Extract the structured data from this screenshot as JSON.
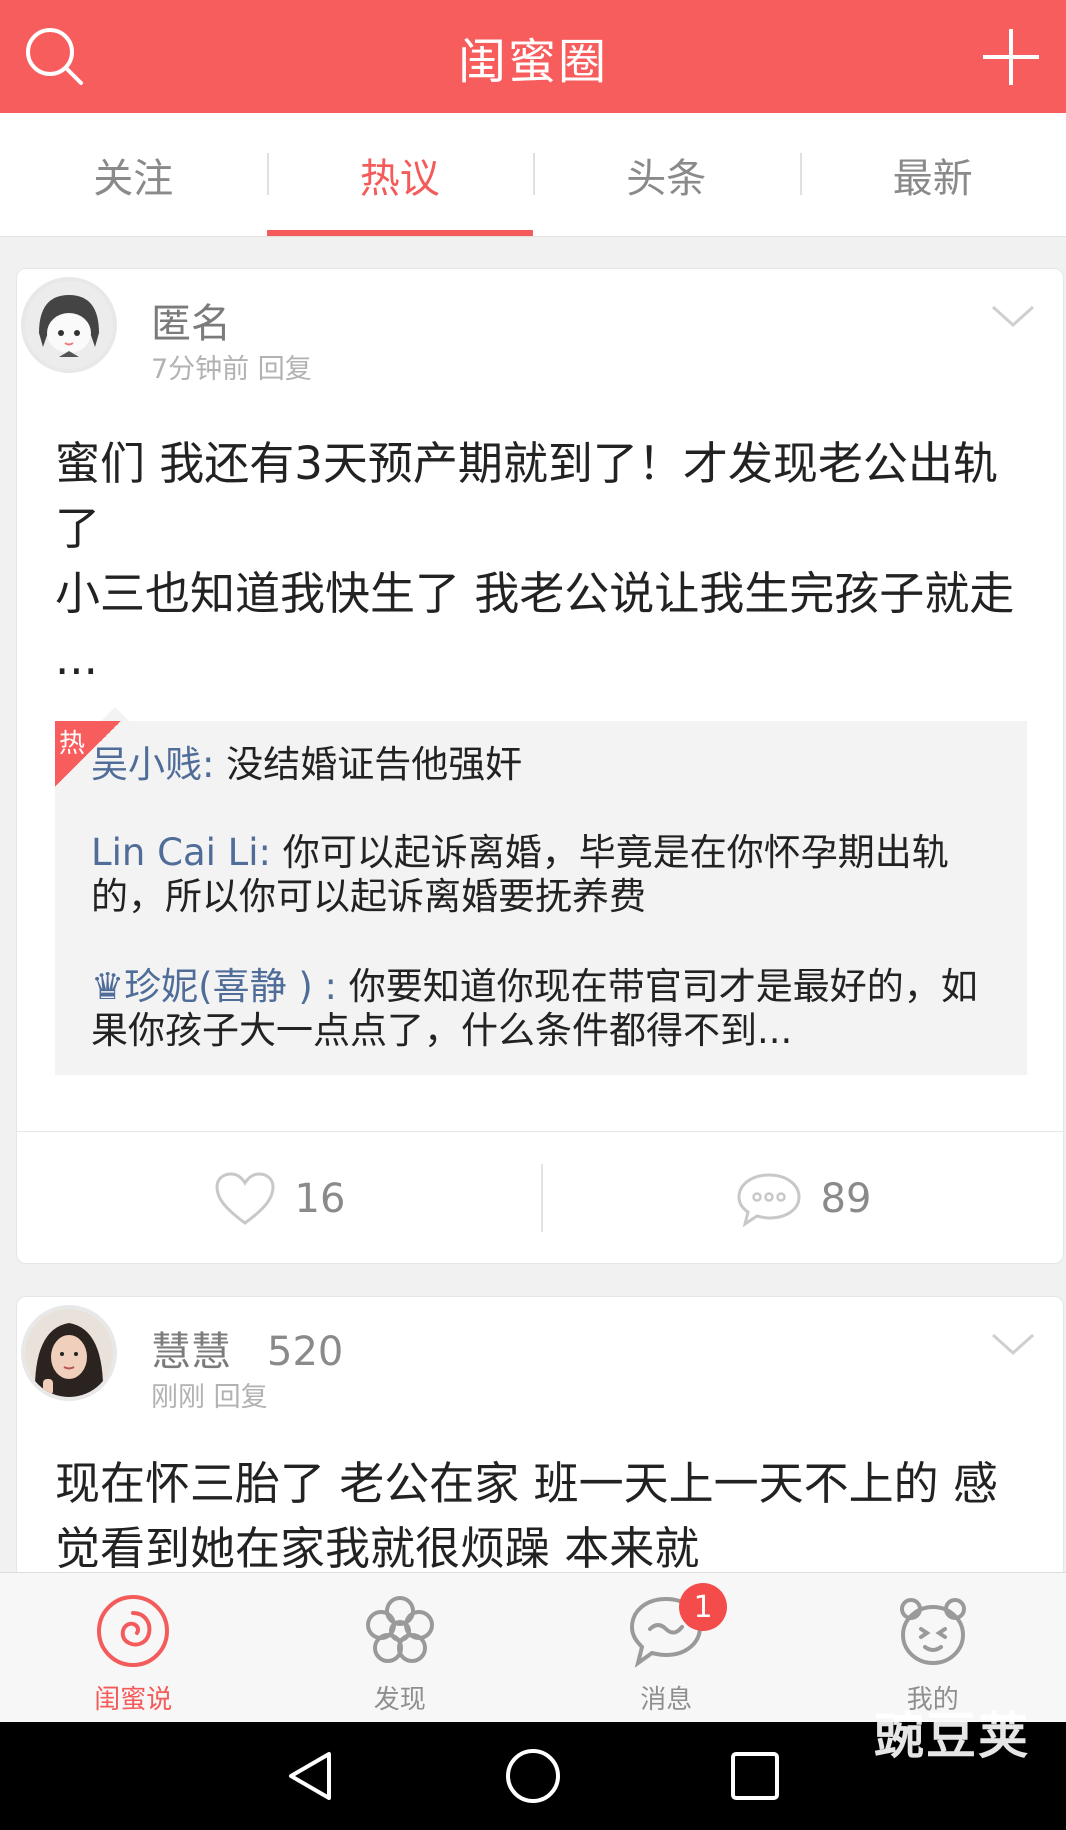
{
  "header": {
    "title": "闺蜜圈",
    "left_icon": "search-icon",
    "right_icon": "plus-icon"
  },
  "tabs": [
    {
      "label": "关注",
      "active": false
    },
    {
      "label": "热议",
      "active": true
    },
    {
      "label": "头条",
      "active": false
    },
    {
      "label": "最新",
      "active": false
    }
  ],
  "posts": [
    {
      "author": "匿名",
      "level": "",
      "time": "7分钟前",
      "reply_label": "回复",
      "text": "蜜们 我还有3天预产期就到了！才发现老公出轨了\n小三也知道我快生了 我老公说让我生完孩子就走 ...",
      "hot_tag": "热",
      "comments": [
        {
          "user": "吴小贱:",
          "text": " 没结婚证告他强奸"
        },
        {
          "user": "Lin Cai Li:",
          "text": " 你可以起诉离婚，毕竟是在你怀孕期出轨的，所以你可以起诉离婚要抚养费"
        },
        {
          "user": "♛珍妮(喜静 ) :",
          "text": " 你要知道你现在带官司才是最好的，如果你孩子大一点点了，什么条件都得不到..."
        }
      ],
      "likes": "16",
      "comment_count": "89"
    },
    {
      "author": "慧慧",
      "level": "520",
      "time": "刚刚",
      "reply_label": "回复",
      "text": "现在怀三胎了   老公在家   班一天上一天不上的   感觉看到她在家我就很烦躁   本来就"
    }
  ],
  "tabbar": [
    {
      "label": "闺蜜说",
      "icon": "swirl-icon",
      "active": true
    },
    {
      "label": "发现",
      "icon": "flower-icon",
      "active": false
    },
    {
      "label": "消息",
      "icon": "message-icon",
      "active": false,
      "badge": "1"
    },
    {
      "label": "我的",
      "icon": "bear-icon",
      "active": false
    }
  ],
  "watermark": "豌豆荚",
  "colors": {
    "brand": "#f85d5d",
    "comment_user": "#4f6d98",
    "navbar": "#000000"
  }
}
